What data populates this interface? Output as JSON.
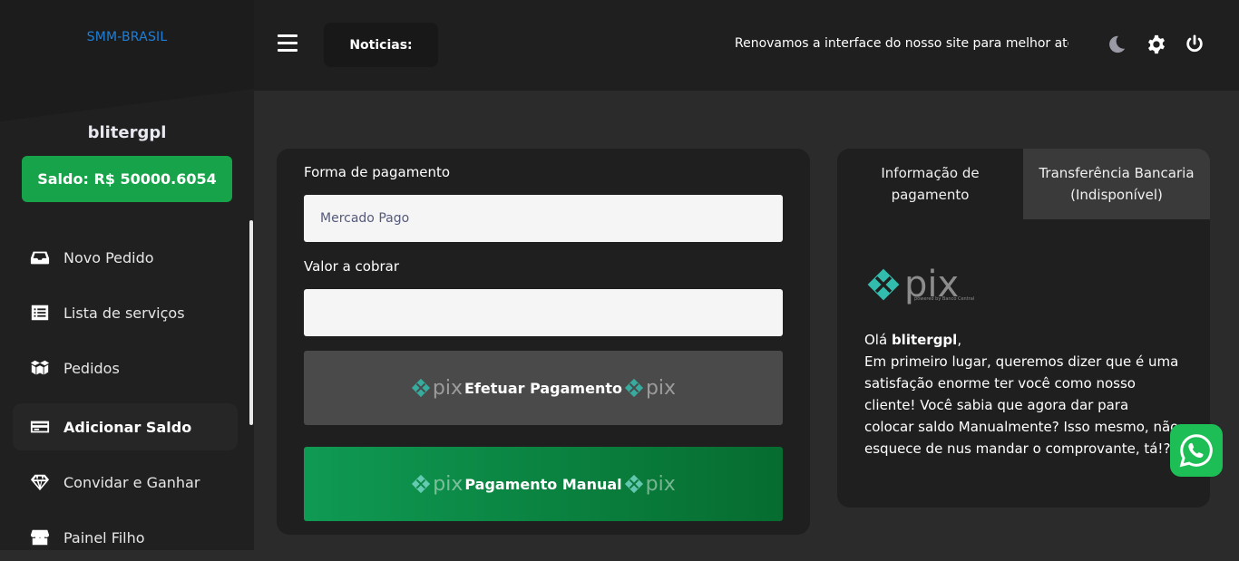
{
  "sidebar": {
    "brand": "SMM-BRASIL",
    "username": "blitergpl",
    "balance": "Saldo: R$ 50000.6054",
    "items": [
      {
        "label": "Novo Pedido",
        "icon": "inbox-icon"
      },
      {
        "label": "Lista de serviços",
        "icon": "list-icon"
      },
      {
        "label": "Pedidos",
        "icon": "boxes-icon"
      },
      {
        "label": "Adicionar Saldo",
        "icon": "credit-card-icon",
        "active": true
      },
      {
        "label": "Convidar e Ganhar",
        "icon": "diamond-icon"
      },
      {
        "label": "Painel Filho",
        "icon": "store-icon"
      }
    ]
  },
  "topbar": {
    "news_label": "Noticias:",
    "news_text": "Renovamos a interface do nosso site para melhor atender"
  },
  "payment_form": {
    "method_label": "Forma de pagamento",
    "method_value": "Mercado Pago",
    "amount_label": "Valor a cobrar",
    "amount_value": "",
    "pay_button": "Efetuar Pagamento",
    "manual_button": "Pagamento Manual",
    "pix_word": "pix"
  },
  "info_panel": {
    "tab_info": "Informação de pagamento",
    "tab_transfer": "Transferência Bancaria (Indisponível)",
    "pix_word": "pix",
    "pix_subtitle": "powered by Banco Central",
    "greeting_prefix": "Olá ",
    "greeting_name": "blitergpl",
    "greeting_suffix": ",",
    "message": "Em primeiro lugar, queremos dizer que é uma satisfação enorme ter você como nosso cliente! Você sabia que agora dar para colocar saldo Manualmente? Isso mesmo, não esquece de nus mandar o comprovante, tá!?"
  },
  "colors": {
    "accent_green": "#16a34a",
    "brand_blue": "#1f7fd8",
    "pix_teal": "#32bcad"
  }
}
